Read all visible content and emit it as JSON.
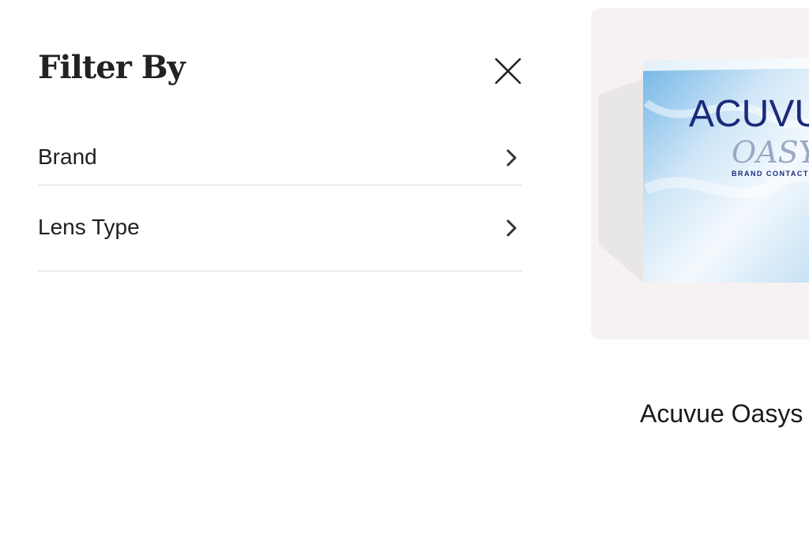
{
  "filter": {
    "title": "Filter By",
    "items": [
      {
        "label": "Brand"
      },
      {
        "label": "Lens Type"
      }
    ]
  },
  "product": {
    "name": "Acuvue Oasys",
    "box_brand_text": "ACUVUE",
    "box_sub_text": "OASYS",
    "box_tagline": "BRAND CONTACT LENSES"
  },
  "colors": {
    "panel_divider": "#d7dfe8",
    "card_background": "#f6f2f2",
    "box_text_navy": "#1b2a7a",
    "box_blue": "#5aa8e0"
  },
  "icons": {
    "close": "close-icon",
    "chevron": "chevron-right-icon"
  }
}
